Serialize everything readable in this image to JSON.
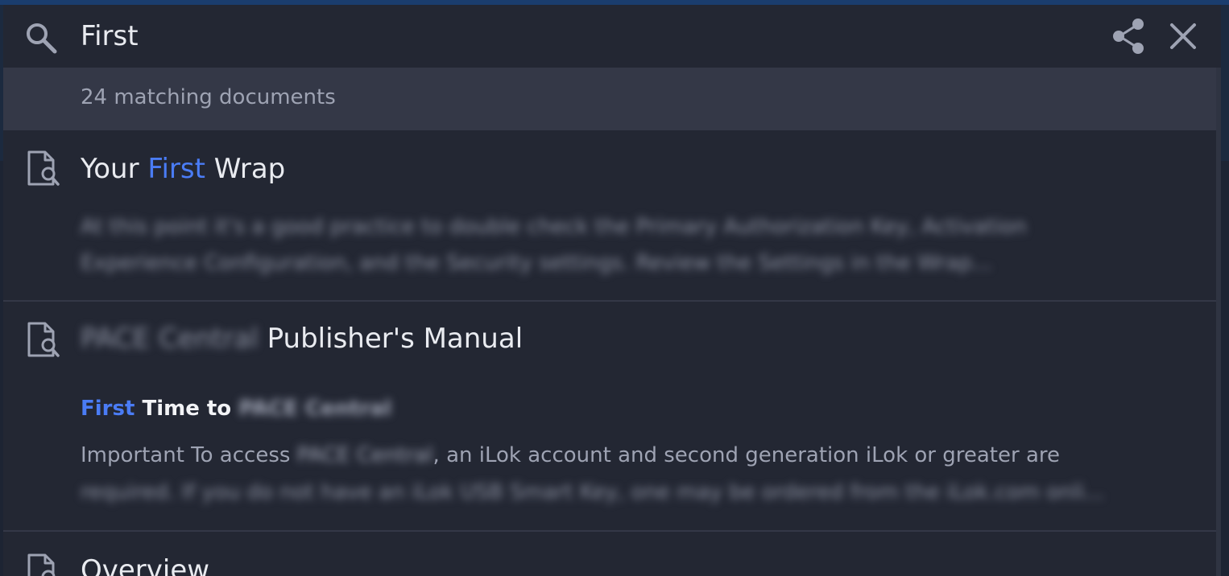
{
  "search": {
    "query": "First",
    "placeholder": "Search"
  },
  "results_count_label": "24 matching documents",
  "results": [
    {
      "title_before": "Your ",
      "title_match": "First",
      "title_after": " Wrap",
      "excerpt_line1": "At this point it's a good practice to double check the Primary Authorization Key, Activation",
      "excerpt_line2": "Experience Configuration, and the Security settings. Review the Settings in the Wrap..."
    },
    {
      "title_redacted": "PACE Central",
      "title_after": " Publisher's Manual",
      "section_match": "First",
      "section_after": " Time to ",
      "section_redacted": "PACE Central",
      "snippet_before": "Important To access ",
      "snippet_redacted": "PACE Central",
      "snippet_after": ", an iLok account and second generation iLok or greater are",
      "snippet_line2": "required. If you do not have an iLok USB Smart Key, one may be ordered from the iLok.com onli..."
    },
    {
      "title": "Overview"
    }
  ],
  "icons": {
    "search": "search-icon",
    "share": "share-icon",
    "close": "close-icon",
    "document": "document-search-icon"
  },
  "colors": {
    "highlight": "#4a7cf5",
    "panel": "#232733",
    "count_row": "#343847"
  }
}
